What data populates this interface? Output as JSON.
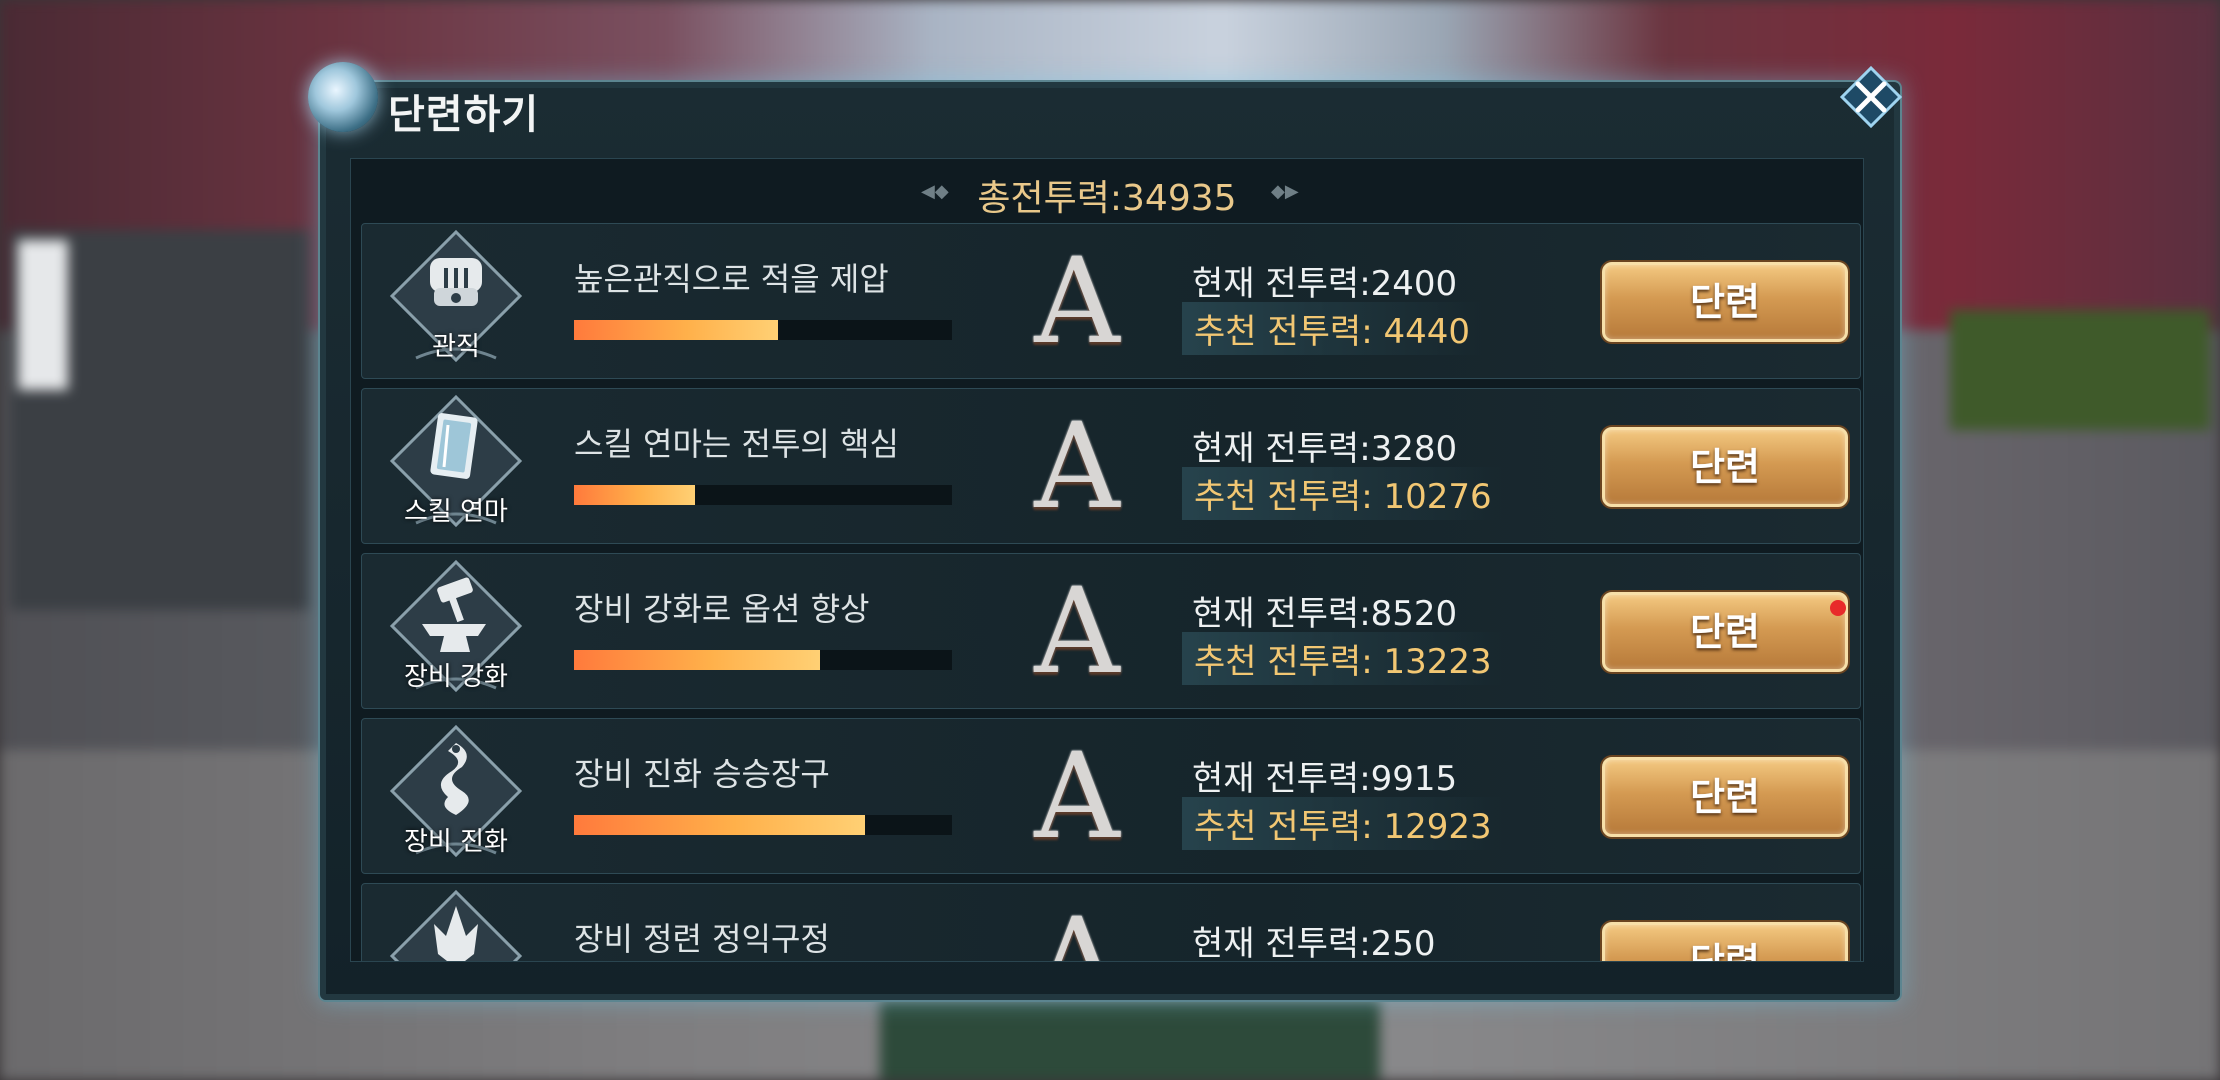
{
  "window": {
    "title": "단련하기"
  },
  "summary": {
    "total_power": "총전투력:34935"
  },
  "rows": [
    {
      "icon": "crown-helmet-icon",
      "icon_label": "관직",
      "quest": "높은관직으로 적을 제압",
      "progress": 0.54,
      "grade": "A",
      "current": "현재 전투력:2400",
      "recommended": "추천 전투력: 4440",
      "button": "단련",
      "notify": false
    },
    {
      "icon": "skill-book-icon",
      "icon_label": "스킬 연마",
      "quest": "스킬 연마는 전투의 핵심",
      "progress": 0.32,
      "grade": "A",
      "current": "현재 전투력:3280",
      "recommended": "추천 전투력: 10276",
      "button": "단련",
      "notify": false
    },
    {
      "icon": "anvil-hammer-icon",
      "icon_label": "장비 강화",
      "quest": "장비 강화로 옵션 향상",
      "progress": 0.65,
      "grade": "A",
      "current": "현재 전투력:8520",
      "recommended": "추천 전투력: 13223",
      "button": "단련",
      "notify": true
    },
    {
      "icon": "serpent-icon",
      "icon_label": "장비 진화",
      "quest": "장비 진화 승승장구",
      "progress": 0.77,
      "grade": "A",
      "current": "현재 전투력:9915",
      "recommended": "추천 전투력: 12923",
      "button": "단련",
      "notify": false
    },
    {
      "icon": "trident-crest-icon",
      "icon_label": "",
      "quest": "장비 정련 정익구정",
      "progress": 0,
      "grade": "A",
      "current": "현재 전투력:250",
      "recommended": "",
      "button": "단련",
      "notify": false
    }
  ],
  "colors": {
    "accent_gold": "#e9c88a",
    "button_gold": "#d49a52",
    "progress_orange": "#ff7a3c",
    "notify_red": "#e82a2a"
  }
}
